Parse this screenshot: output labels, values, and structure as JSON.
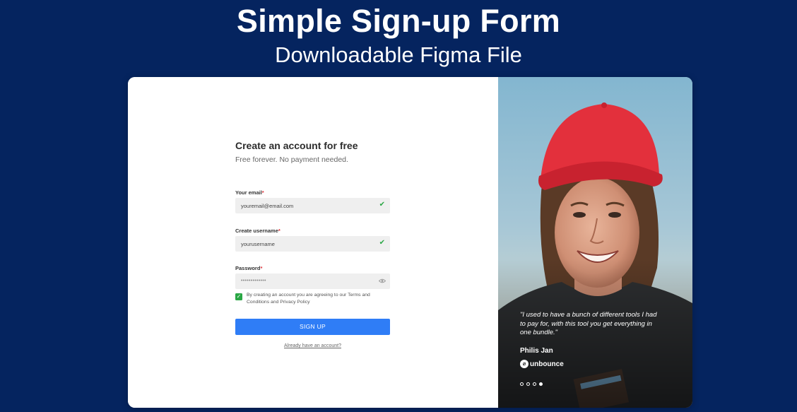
{
  "hero": {
    "title": "Simple Sign-up Form",
    "subtitle": "Downloadable Figma File"
  },
  "form": {
    "title": "Create an account for free",
    "subtitle": "Free forever. No payment needed.",
    "email": {
      "label": "Your email",
      "required": "*",
      "value": "youremail@email.com",
      "status_icon": "check-icon"
    },
    "username": {
      "label": "Create username",
      "required": "*",
      "value": "yourusername",
      "status_icon": "check-icon"
    },
    "password": {
      "label": "Password",
      "required": "*",
      "value": "•••••••••••••",
      "toggle_icon": "eye-icon"
    },
    "terms": {
      "checked": true,
      "text": "By creating an account you are agreeing to our Terms and Conditions and Privacy Policy"
    },
    "submit_label": "SIGN UP",
    "signin_link": "Already have an account?"
  },
  "testimonial": {
    "quote": "\"I used to have a bunch of different tools I had to pay for, with this tool you get everything in one bundle.\"",
    "author": "Philis Jan",
    "brand": "unbounce",
    "dots_total": 4,
    "dots_active": 4
  },
  "colors": {
    "background": "#05245f",
    "primary": "#2f7df6",
    "success": "#2aa745",
    "required": "#e0333a"
  }
}
